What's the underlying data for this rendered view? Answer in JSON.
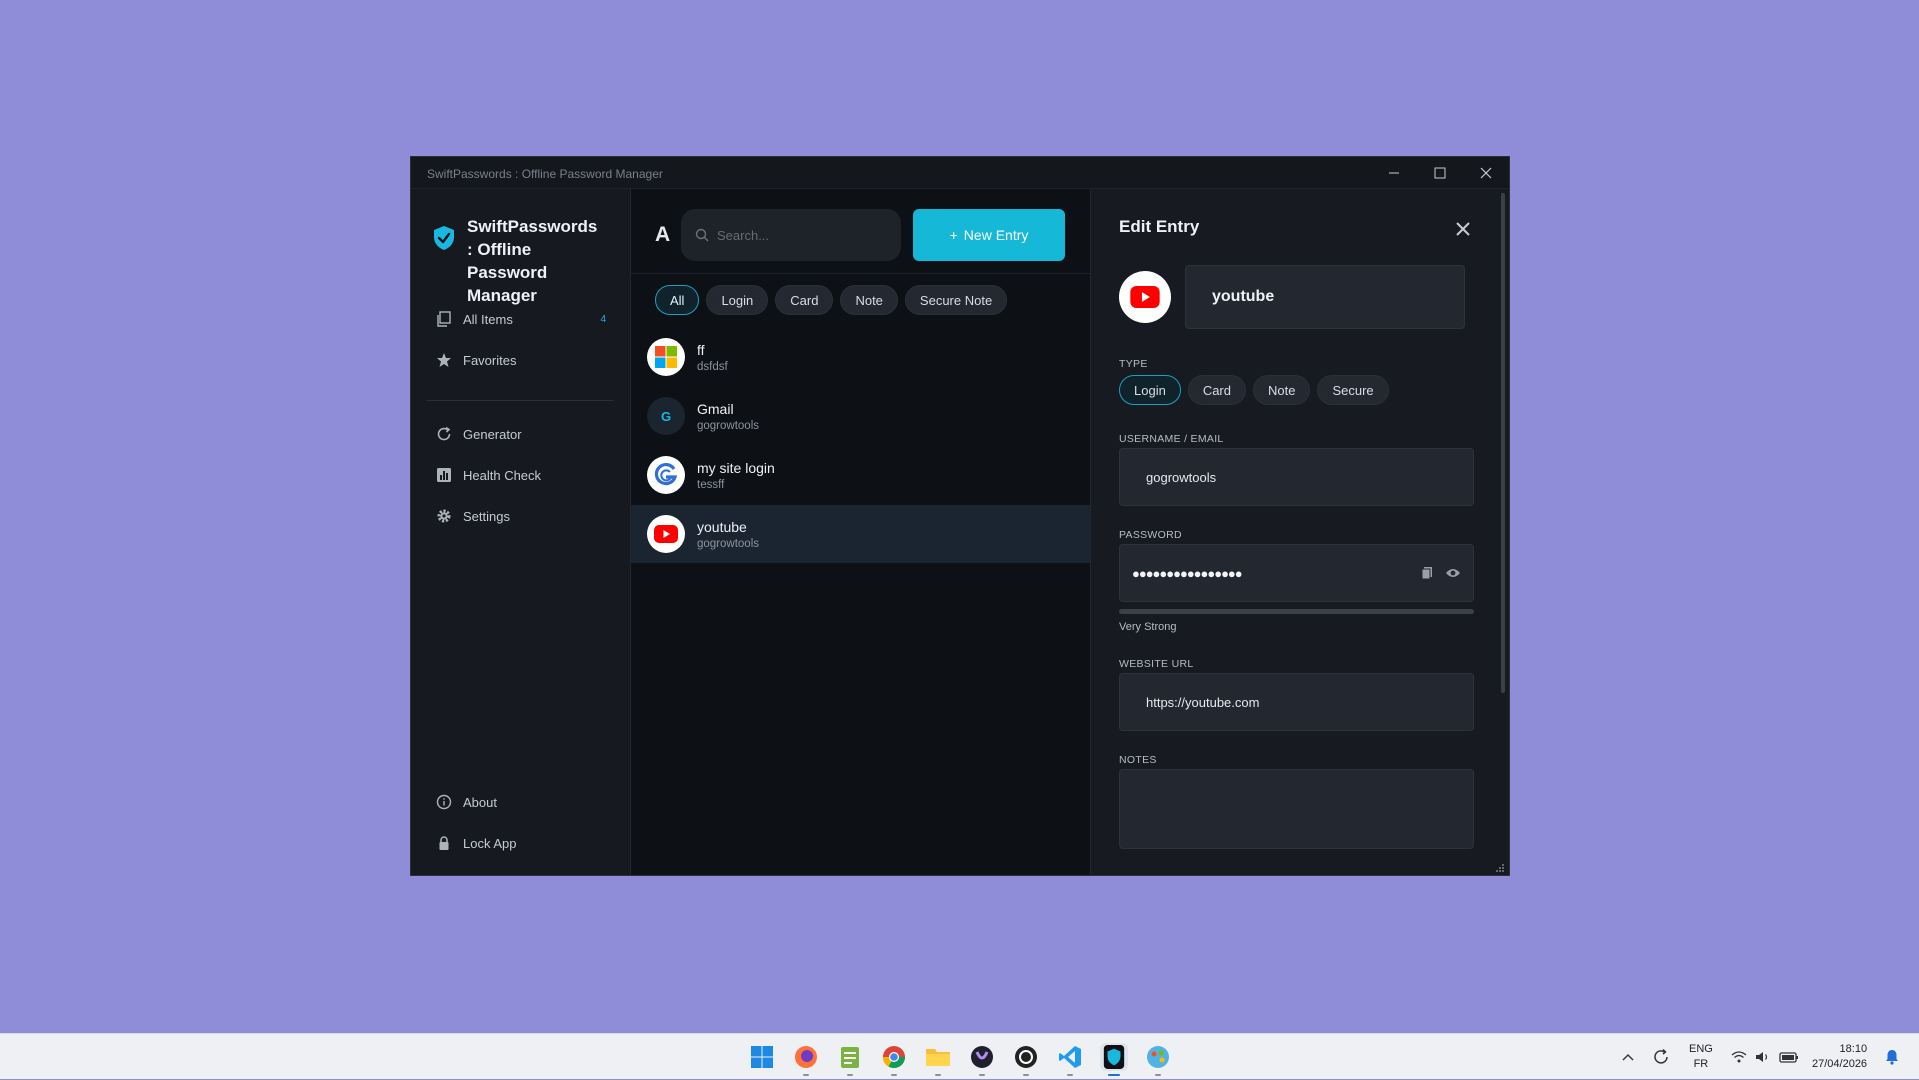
{
  "window": {
    "title": "SwiftPasswords : Offline Password Manager",
    "controls": [
      "minimize",
      "maximize",
      "close"
    ]
  },
  "sidebar": {
    "brand": "SwiftPasswords : Offline Password Manager",
    "items": [
      {
        "label": "All Items",
        "icon": "copy-icon",
        "badge": "4"
      },
      {
        "label": "Favorites",
        "icon": "star-icon"
      },
      {
        "label": "Generator",
        "icon": "refresh-icon"
      },
      {
        "label": "Health Check",
        "icon": "chart-icon"
      },
      {
        "label": "Settings",
        "icon": "gear-icon"
      }
    ],
    "bottom": [
      {
        "label": "About",
        "icon": "info-icon"
      },
      {
        "label": "Lock App",
        "icon": "lock-icon"
      }
    ]
  },
  "list": {
    "user_initial": "A",
    "search_placeholder": "Search...",
    "new_entry_label": "New Entry",
    "filters": [
      "All",
      "Login",
      "Card",
      "Note",
      "Secure Note"
    ],
    "active_filter": "All",
    "entries": [
      {
        "title": "ff",
        "subtitle": "dsfdsf",
        "icon": "microsoft-logo-icon"
      },
      {
        "title": "Gmail",
        "subtitle": "gogrowtools",
        "icon": "letter-g-icon",
        "initial": "G"
      },
      {
        "title": "my site login",
        "subtitle": "tessff",
        "icon": "g-logo-icon"
      },
      {
        "title": "youtube",
        "subtitle": "gogrowtools",
        "icon": "youtube-logo-icon",
        "selected": true
      }
    ]
  },
  "edit": {
    "title": "Edit Entry",
    "name_value": "youtube",
    "type_label": "TYPE",
    "types": [
      "Login",
      "Card",
      "Note",
      "Secure"
    ],
    "active_type": "Login",
    "username_label": "USERNAME / EMAIL",
    "username_value": "gogrowtools",
    "password_label": "PASSWORD",
    "password_mask": "●●●●●●●●●●●●●●●●",
    "strength_text": "Very Strong",
    "strength_fraction": 1.0,
    "url_label": "WEBSITE URL",
    "url_value": "https://youtube.com",
    "notes_label": "NOTES",
    "notes_value": ""
  },
  "taskbar": {
    "apps": [
      "windows-start-icon",
      "firefox-icon",
      "notepad-icon",
      "chrome-icon",
      "file-explorer-icon",
      "app-icon",
      "obs-icon",
      "vscode-icon",
      "swiftpasswords-icon",
      "paint-icon"
    ],
    "tray": {
      "lang_top": "ENG",
      "lang_bottom": "FR",
      "time": "18:10",
      "date": "27/04/2026"
    }
  },
  "colors": {
    "accent": "#16b8d8",
    "desktop": "#8f8cd8",
    "sidebar_bg": "#16191f",
    "list_bg": "#0d1116",
    "edit_bg": "#171b21"
  }
}
